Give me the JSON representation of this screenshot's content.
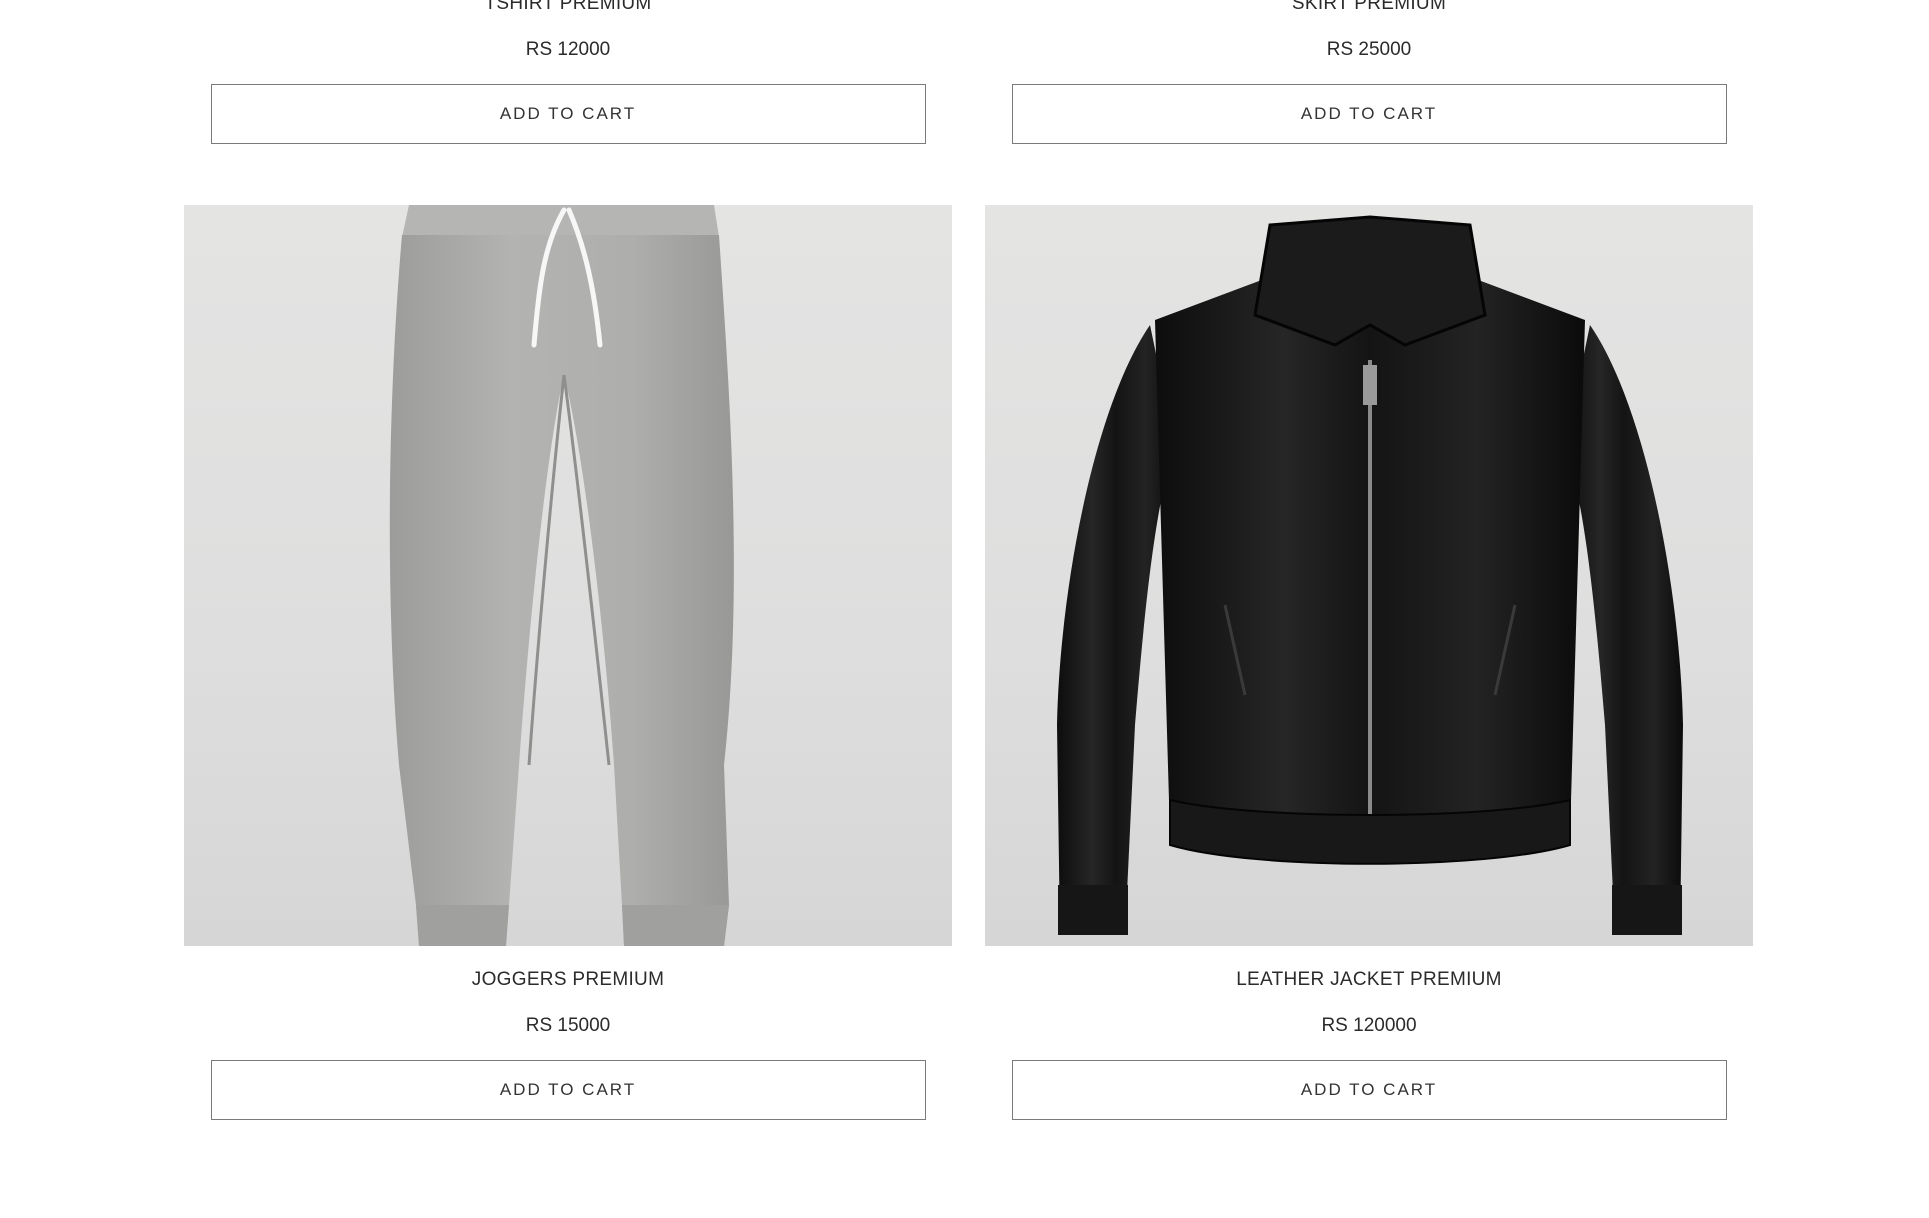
{
  "products": [
    {
      "name": "TSHIRT PREMIUM",
      "price": "RS 12000",
      "cta": "ADD TO CART",
      "image_icon": "tshirt-icon"
    },
    {
      "name": "SKIRT PREMIUM",
      "price": "RS 25000",
      "cta": "ADD TO CART",
      "image_icon": "skirt-icon"
    },
    {
      "name": "JOGGERS PREMIUM",
      "price": "RS 15000",
      "cta": "ADD TO CART",
      "image_icon": "joggers-image"
    },
    {
      "name": "LEATHER JACKET PREMIUM",
      "price": "RS 120000",
      "cta": "ADD TO CART",
      "image_icon": "leather-jacket-image"
    }
  ],
  "colors": {
    "background": "#ffffff",
    "image_background": "#e0e0df",
    "button_border": "#7a7a7a",
    "text": "#2b2b2b",
    "joggers": "#a9a9a7",
    "jacket": "#141414"
  }
}
